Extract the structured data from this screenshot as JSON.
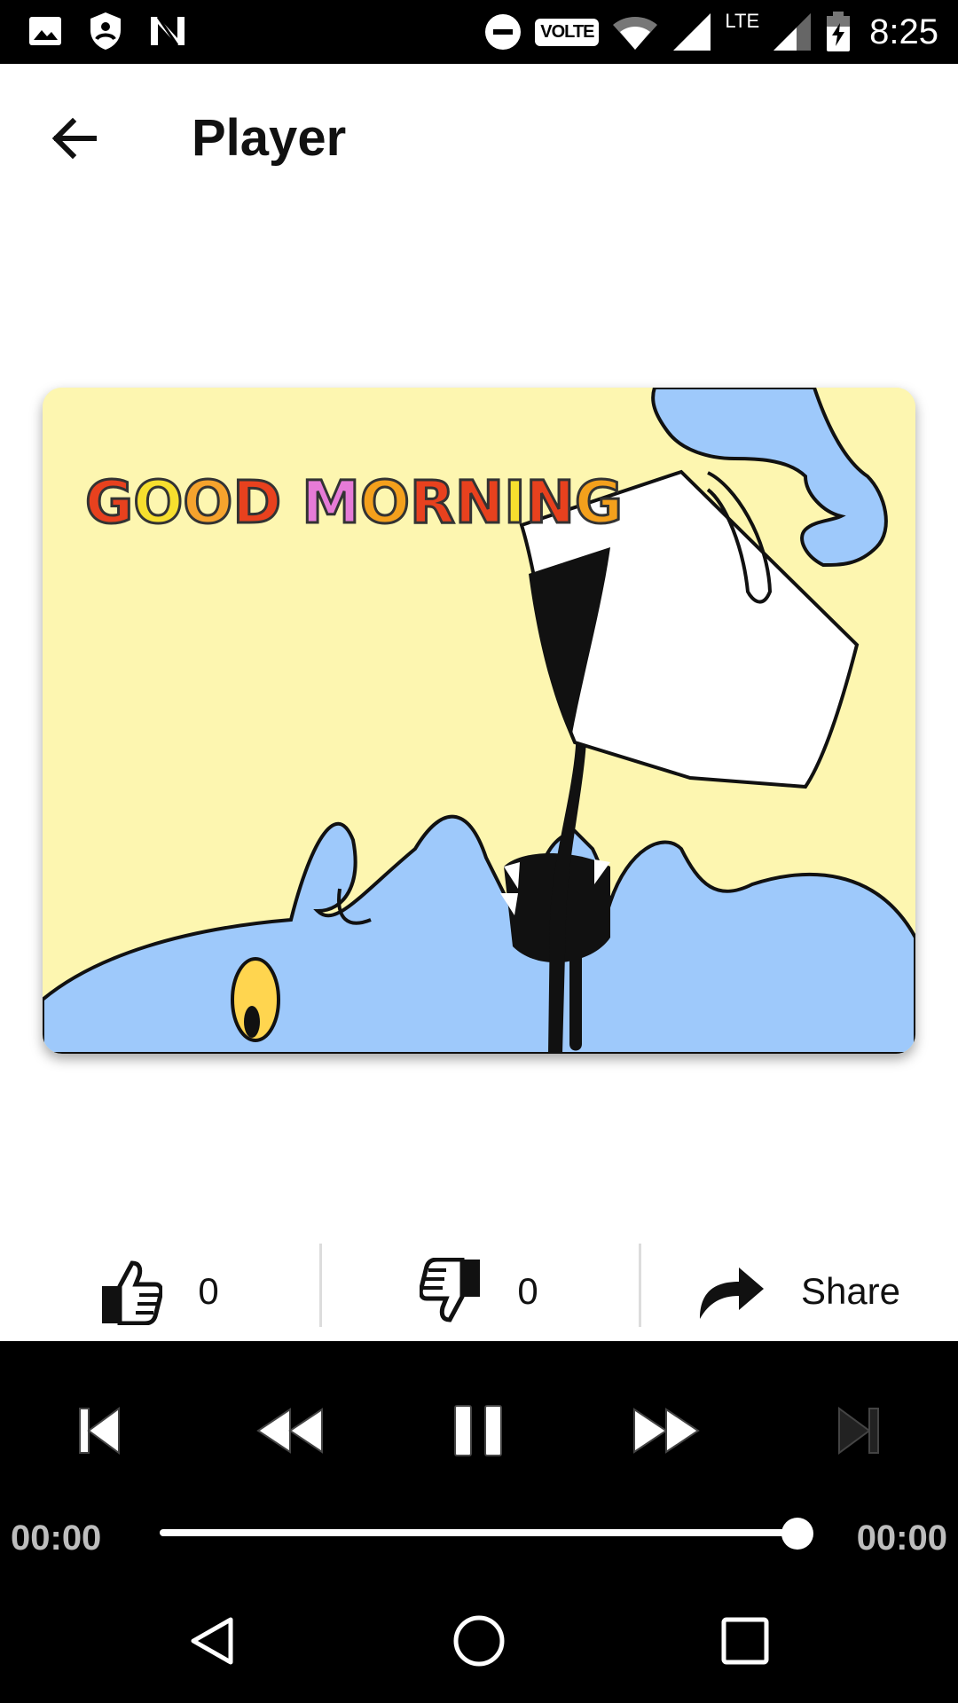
{
  "status_bar": {
    "time": "8:25",
    "volte": "VOLTE",
    "lte": "LTE",
    "icons": [
      "gallery-icon",
      "shield-icon",
      "n-icon",
      "dnd-icon",
      "wifi-icon",
      "signal-icon",
      "battery-charging-icon"
    ]
  },
  "app_bar": {
    "title": "Player",
    "back_icon": "arrow-left-icon"
  },
  "media": {
    "image_text": "GOOD MORNING"
  },
  "actions": {
    "like_count": "0",
    "dislike_count": "0",
    "share_label": "Share"
  },
  "player": {
    "current_time": "00:00",
    "total_time": "00:00",
    "progress": 1.0,
    "controls": [
      "skip-previous-icon",
      "rewind-icon",
      "pause-icon",
      "fast-forward-icon",
      "skip-next-icon"
    ]
  },
  "nav_bar": {
    "icons": [
      "nav-back-icon",
      "nav-home-icon",
      "nav-recents-icon"
    ]
  },
  "colors": {
    "card_bg": "#fdf6b0",
    "face": "#9ec9fb",
    "player_bg": "#000000"
  }
}
